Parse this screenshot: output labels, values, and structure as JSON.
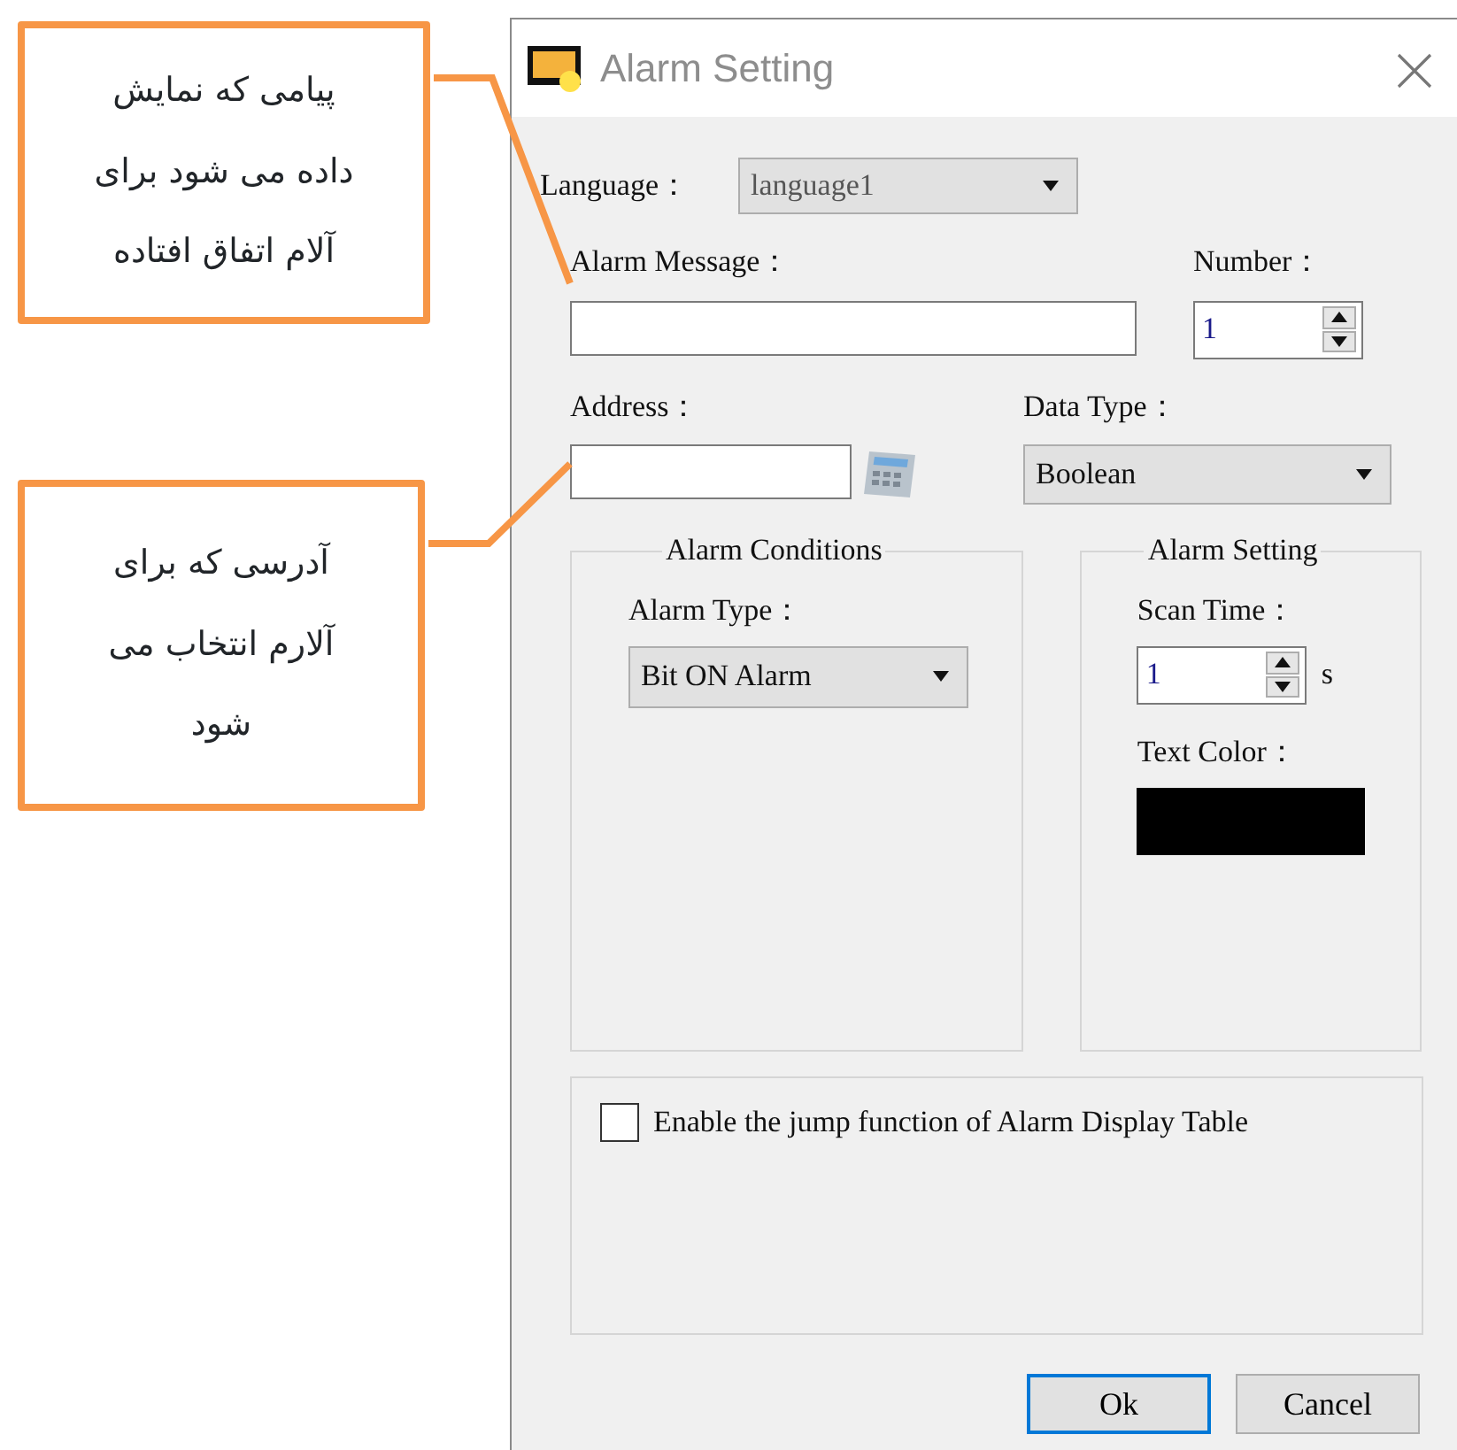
{
  "annotations": [
    {
      "text": "پیامی که نمایش داده می شود برای آلام اتفاق افتاده"
    },
    {
      "text": "آدرسی که برای آلارم انتخاب می شود"
    }
  ],
  "window": {
    "title": "Alarm Setting"
  },
  "language": {
    "label": "Language：",
    "value": "language1"
  },
  "alarm_message": {
    "label": "Alarm Message："
  },
  "number": {
    "label": "Number：",
    "value": "1"
  },
  "address": {
    "label": "Address："
  },
  "data_type": {
    "label": "Data Type：",
    "value": "Boolean"
  },
  "alarm_conditions": {
    "title": "Alarm Conditions",
    "alarm_type": {
      "label": "Alarm Type：",
      "value": "Bit ON Alarm"
    }
  },
  "alarm_setting": {
    "title": "Alarm Setting",
    "scan_time": {
      "label": "Scan Time：",
      "value": "1",
      "unit": "s"
    },
    "text_color": {
      "label": "Text Color：",
      "color": "#000000"
    }
  },
  "jump": {
    "label": "Enable the jump function of Alarm Display Table",
    "checked": false
  },
  "buttons": [
    {
      "label": "Ok",
      "default": true
    },
    {
      "label": "Cancel",
      "default": false
    }
  ]
}
